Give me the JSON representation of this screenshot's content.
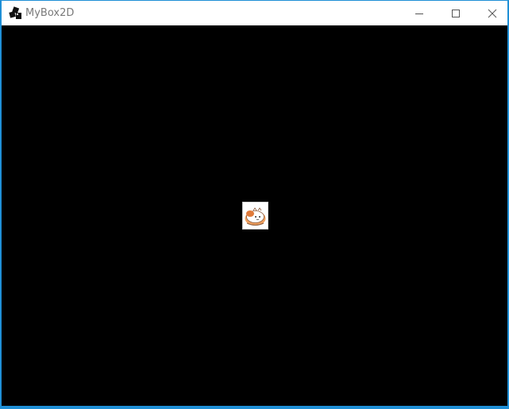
{
  "window": {
    "title": "MyBox2D",
    "accent_color": "#1f8fd6",
    "controls": {
      "minimize_icon": "minimize-icon",
      "maximize_icon": "maximize-icon",
      "close_icon": "close-icon"
    }
  },
  "canvas": {
    "background": "#000000",
    "sprite_icon": "sushi-cat-icon"
  }
}
